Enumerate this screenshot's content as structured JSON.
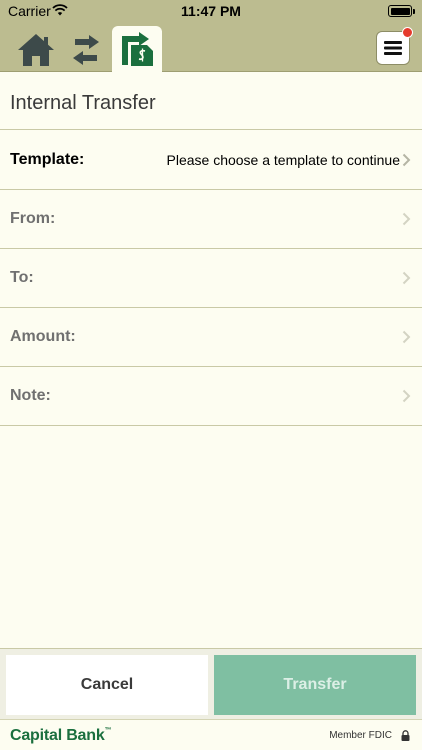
{
  "status_bar": {
    "carrier": "Carrier",
    "time": "11:47 PM"
  },
  "nav": {
    "home_icon": "home-icon",
    "transfer_icon": "swap-arrows-icon",
    "active_icon": "internal-transfer-icon",
    "menu_icon": "hamburger-menu-icon",
    "badge_color": "#e53b2c"
  },
  "page": {
    "title": "Internal Transfer"
  },
  "form": {
    "template_label": "Template:",
    "template_value": "Please choose a template to continue",
    "from_label": "From:",
    "to_label": "To:",
    "amount_label": "Amount:",
    "note_label": "Note:"
  },
  "actions": {
    "cancel_label": "Cancel",
    "transfer_label": "Transfer"
  },
  "footer": {
    "brand": "Capital Bank",
    "brand_mark": "™",
    "member": "Member FDIC"
  },
  "colors": {
    "header": "#bcbc90",
    "background": "#fdfdf1",
    "accent": "#1b6f3e",
    "transfer_button": "#7fbfa2"
  }
}
